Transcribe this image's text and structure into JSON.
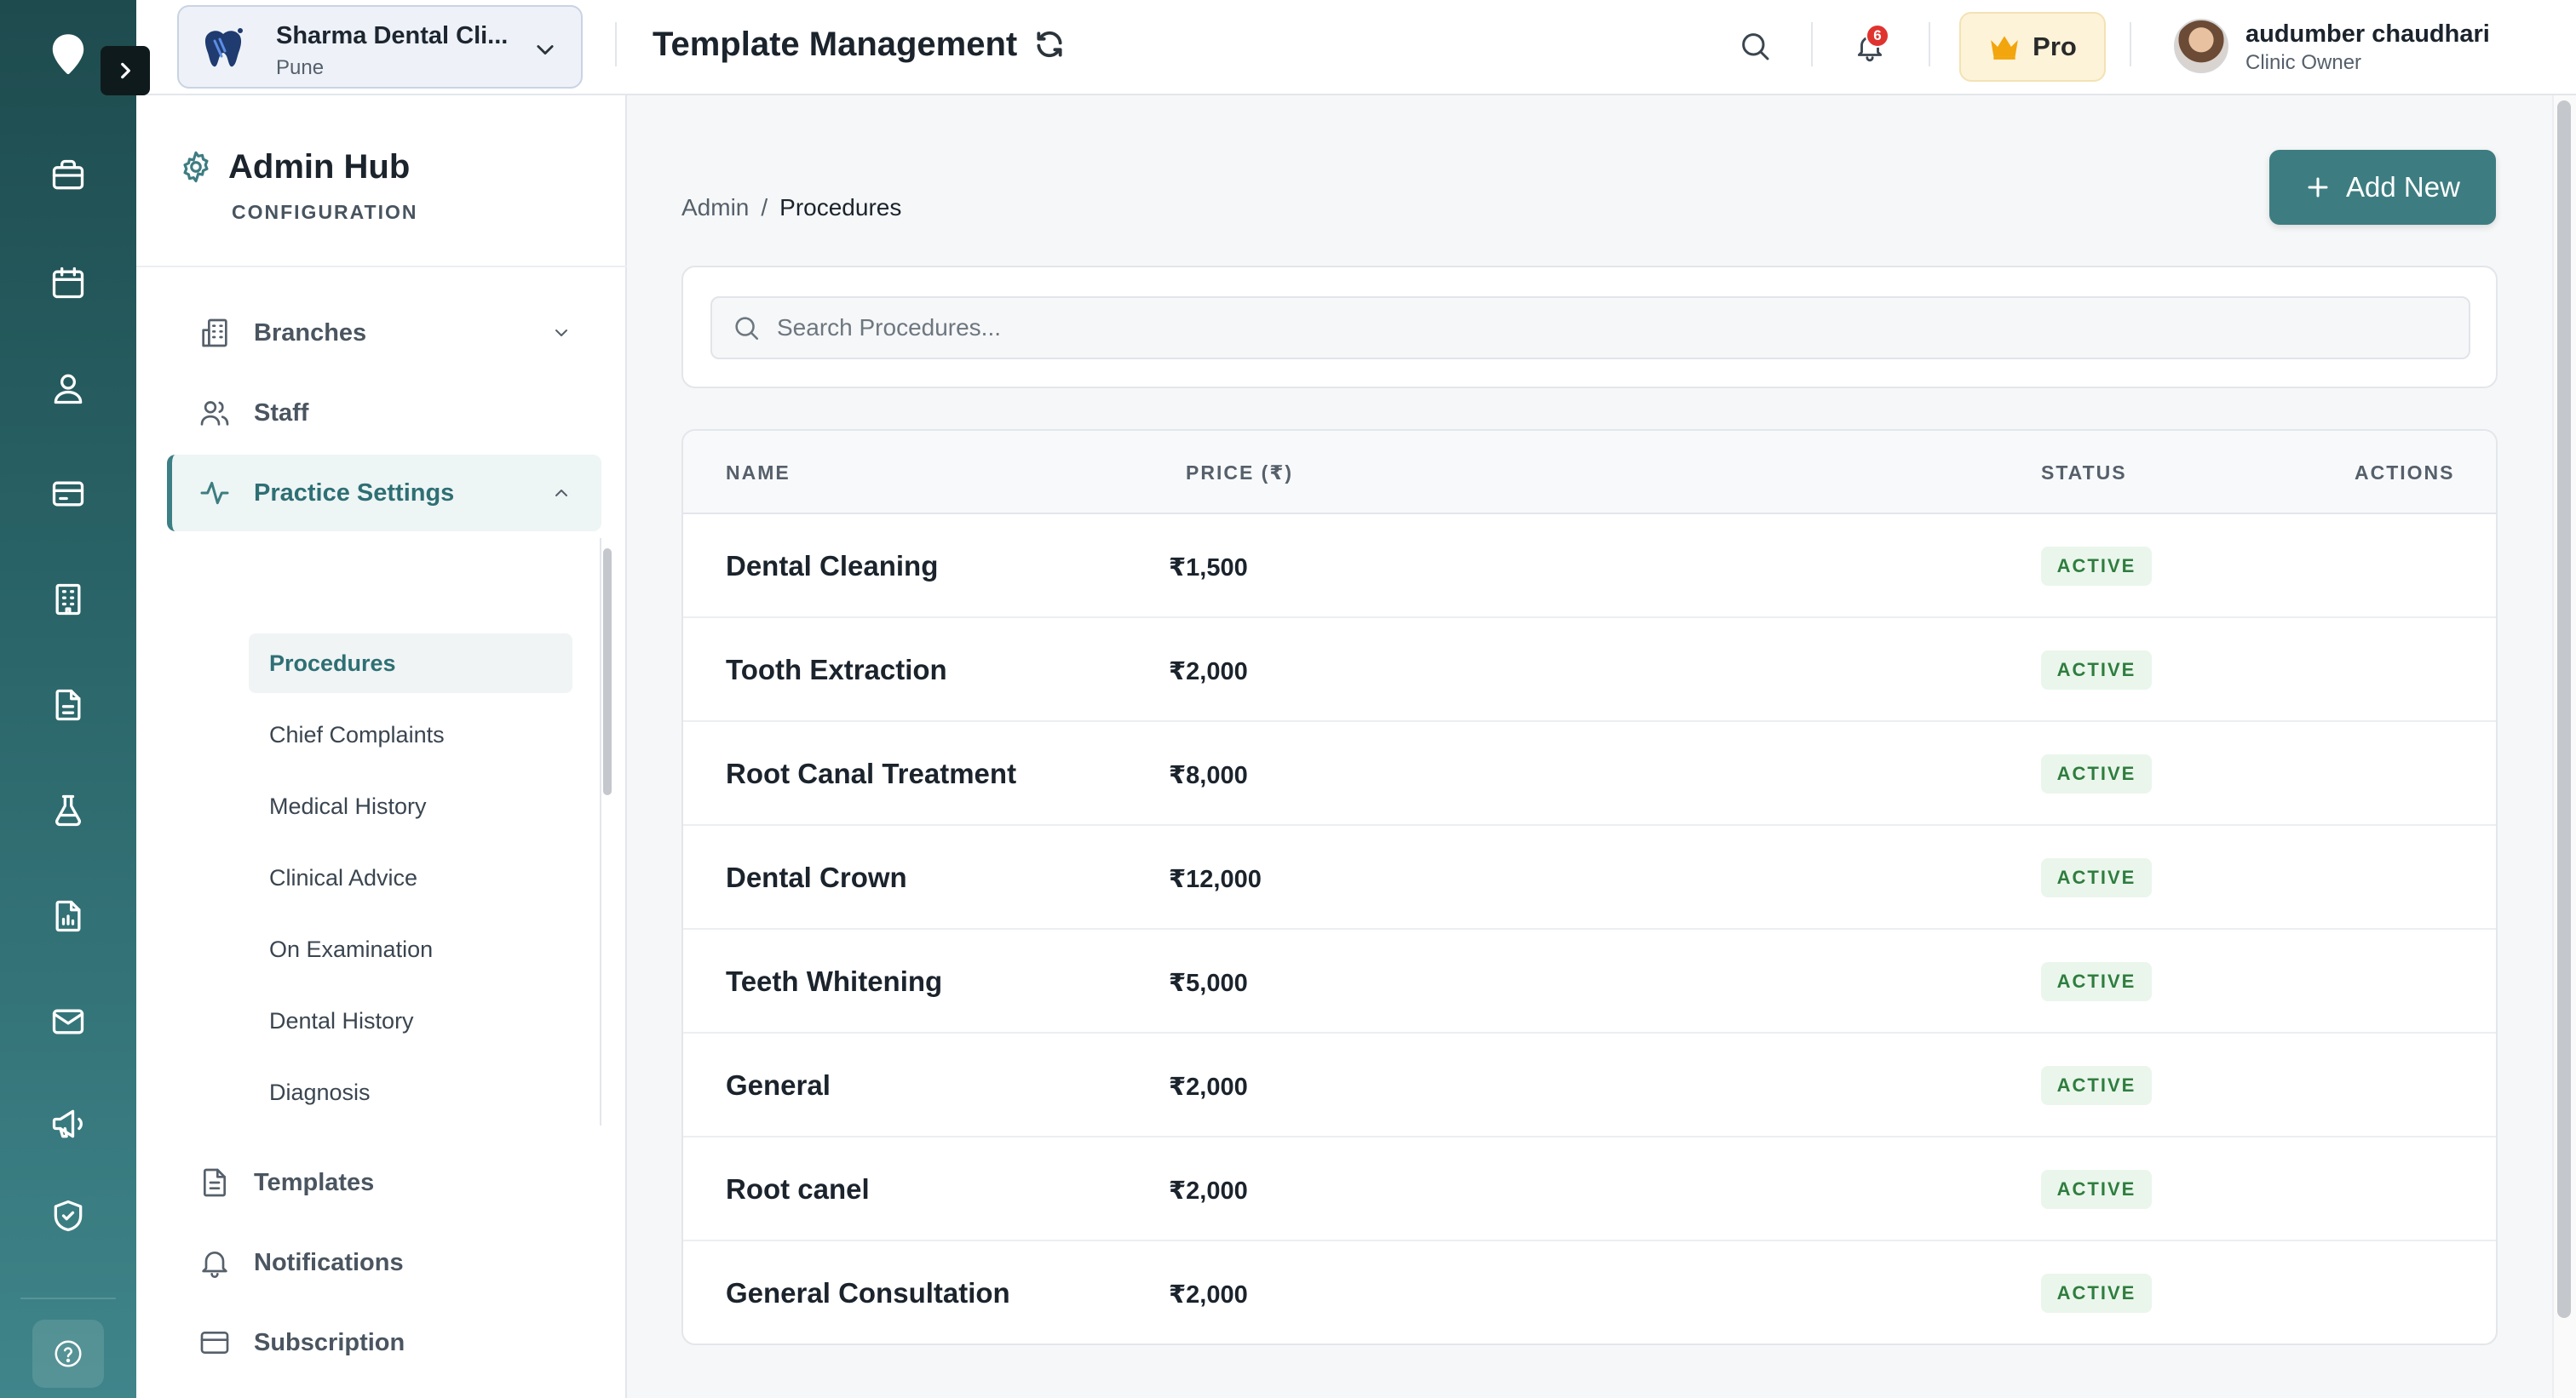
{
  "header": {
    "clinic_name": "Sharma Dental Cli...",
    "clinic_city": "Pune",
    "page_title": "Template Management",
    "notification_count": "6",
    "pro_label": "Pro",
    "user_name": "audumber chaudhari",
    "user_role": "Clinic Owner"
  },
  "rail": {
    "items": [
      "location-icon",
      "briefcase-icon",
      "calendar-icon",
      "user-icon",
      "card-icon",
      "building-icon",
      "document-icon",
      "flask-icon",
      "report-icon",
      "mail-icon",
      "megaphone-icon",
      "shield-icon",
      "help-icon"
    ]
  },
  "sidebar": {
    "title": "Admin Hub",
    "subtitle": "CONFIGURATION",
    "items": [
      {
        "label": "Branches",
        "icon": "building-icon"
      },
      {
        "label": "Staff",
        "icon": "users-icon"
      },
      {
        "label": "Practice Settings",
        "icon": "activity-icon"
      },
      {
        "label": "Templates",
        "icon": "document-icon"
      },
      {
        "label": "Notifications",
        "icon": "bell-icon"
      },
      {
        "label": "Subscription",
        "icon": "card-icon"
      }
    ],
    "sub_items": [
      "Procedures",
      "Chief Complaints",
      "Medical History",
      "Clinical Advice",
      "On Examination",
      "Dental History",
      "Diagnosis"
    ]
  },
  "breadcrumb": {
    "root": "Admin",
    "separator": "/",
    "current": "Procedures"
  },
  "add_button_label": "Add New",
  "search": {
    "placeholder": "Search Procedures..."
  },
  "table": {
    "columns": [
      "NAME",
      "PRICE (₹)",
      "STATUS",
      "ACTIONS"
    ],
    "rows": [
      {
        "name": "Dental Cleaning",
        "price": "₹1,500",
        "status": "ACTIVE"
      },
      {
        "name": "Tooth Extraction",
        "price": "₹2,000",
        "status": "ACTIVE"
      },
      {
        "name": "Root Canal Treatment",
        "price": "₹8,000",
        "status": "ACTIVE"
      },
      {
        "name": "Dental Crown",
        "price": "₹12,000",
        "status": "ACTIVE"
      },
      {
        "name": "Teeth Whitening",
        "price": "₹5,000",
        "status": "ACTIVE"
      },
      {
        "name": "General",
        "price": "₹2,000",
        "status": "ACTIVE"
      },
      {
        "name": "Root canel",
        "price": "₹2,000",
        "status": "ACTIVE"
      },
      {
        "name": "General Consultation",
        "price": "₹2,000",
        "status": "ACTIVE"
      }
    ]
  },
  "colors": {
    "accent": "#3d7d81",
    "rail_top": "#1e4b4e",
    "badge_green": "#2f7d3e",
    "notification_red": "#e0332f",
    "pro_bg": "#fdf3d9"
  }
}
